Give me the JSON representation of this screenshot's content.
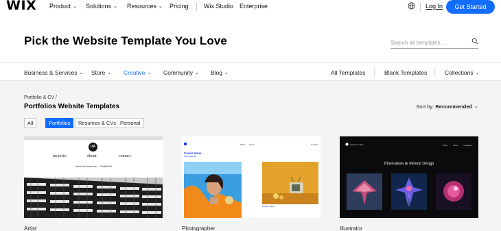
{
  "brand": "WIX",
  "topnav": {
    "items": [
      "Product",
      "Solutions",
      "Resources",
      "Pricing",
      "Wix Studio",
      "Enterprise"
    ],
    "login": "Log In",
    "cta": "Get Started"
  },
  "page": {
    "title": "Pick the Website Template You Love",
    "search_placeholder": "Search all templates..."
  },
  "categories": {
    "left": [
      "Business & Services",
      "Store",
      "Creative",
      "Community",
      "Blog"
    ],
    "active": "Creative",
    "right": [
      "All Templates",
      "Blank Templates",
      "Collections"
    ]
  },
  "section": {
    "breadcrumb": "Portfolio & CV /",
    "title": "Portfolios Website Templates",
    "sort_label": "Sort by:",
    "sort_value": "Recommended"
  },
  "filters": [
    "All",
    "Portfolios",
    "Resumes & CVs",
    "Personal"
  ],
  "filter_active": "Portfolios",
  "cards": [
    {
      "label": "Artist",
      "preview": {
        "logo": "UA",
        "links": [
          "projects.",
          "about.",
          "contact."
        ],
        "subtitle": "Urban Adventures – Graffiti Art"
      }
    },
    {
      "label": "Photographer",
      "preview": {
        "name": "Conor Kane",
        "role": "Photographer",
        "nav": [
          "Work",
          "About",
          "Contact"
        ],
        "caption": "Mellow Yellow"
      }
    },
    {
      "label": "Illustrator",
      "preview": {
        "brand": "Carmen Lopez",
        "title": "Illustrations & Motion Design",
        "nav": [
          "Work",
          "About",
          "Instagram"
        ]
      }
    }
  ],
  "colors": {
    "accent": "#116dff",
    "section_bg": "#f4f4f4"
  }
}
